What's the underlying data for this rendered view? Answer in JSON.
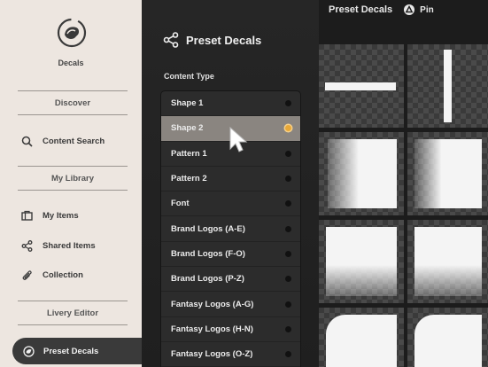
{
  "sidebar": {
    "app_title": "Decals",
    "discover_label": "Discover",
    "content_search_label": "Content Search",
    "my_library_label": "My Library",
    "my_items_label": "My Items",
    "shared_items_label": "Shared Items",
    "collection_label": "Collection",
    "livery_editor_label": "Livery Editor",
    "preset_decals_label": "Preset Decals"
  },
  "panel": {
    "title": "Preset Decals",
    "content_type_label": "Content Type",
    "items": [
      {
        "label": "Shape 1",
        "selected": false
      },
      {
        "label": "Shape 2",
        "selected": true
      },
      {
        "label": "Pattern 1",
        "selected": false
      },
      {
        "label": "Pattern 2",
        "selected": false
      },
      {
        "label": "Font",
        "selected": false
      },
      {
        "label": "Brand Logos (A-E)",
        "selected": false
      },
      {
        "label": "Brand Logos (F-O)",
        "selected": false
      },
      {
        "label": "Brand Logos (P-Z)",
        "selected": false
      },
      {
        "label": "Fantasy Logos (A-G)",
        "selected": false
      },
      {
        "label": "Fantasy Logos (H-N)",
        "selected": false
      },
      {
        "label": "Fantasy Logos (O-Z)",
        "selected": false
      }
    ]
  },
  "grid": {
    "title": "Preset Decals",
    "pin_label": "Pin"
  },
  "colors": {
    "sidebar_bg": "#ede6e0",
    "panel_bg": "#262626",
    "selected_row": "#8a8580",
    "selected_dot": "#e8a838"
  },
  "icons": {
    "logo": "decal-logo-icon",
    "search": "search-icon",
    "my_items": "folder-icon",
    "shared": "share-icon",
    "collection": "paperclip-icon",
    "preset": "decal-icon",
    "pin": "pin-icon",
    "cursor": "mouse-pointer-icon"
  }
}
